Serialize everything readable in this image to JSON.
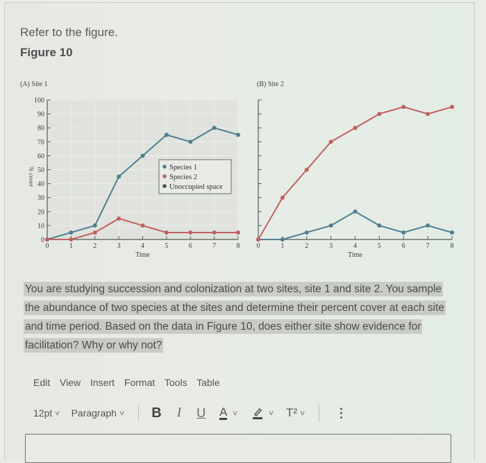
{
  "question": {
    "intro": "Refer to the figure.",
    "figure_title": "Figure 10",
    "text": "You are studying succession and colonization at two sites, site 1 and site 2. You sample the abundance of two species at the sites and determine their percent cover at each site and time period. Based on the data in Figure 10, does either site show evidence for facilitation? Why or why not?"
  },
  "editor": {
    "menu": [
      "Edit",
      "View",
      "Insert",
      "Format",
      "Tools",
      "Table"
    ],
    "font_size": "12pt",
    "block_format": "Paragraph",
    "buttons": {
      "bold": "B",
      "italic": "I",
      "underline": "U",
      "text_color": "A",
      "superscript": "T²",
      "more": "⋮"
    },
    "content": ""
  },
  "colors": {
    "species1": "#4f7f8e",
    "species2": "#c0605e",
    "unoccupied": "#3c5a4a",
    "axis": "#555a55",
    "plot_bg": "#dfe2dd"
  },
  "chart_data": [
    {
      "type": "line",
      "title": "(A) Site 1",
      "xlabel": "Time",
      "ylabel": "% cover",
      "x": [
        0,
        1,
        2,
        3,
        4,
        5,
        6,
        7,
        8
      ],
      "xticks": [
        "0",
        "1",
        "2",
        "3",
        "4",
        "5",
        "6",
        "7",
        "8"
      ],
      "yticks": [
        "0",
        "10",
        "20",
        "30",
        "40",
        "50",
        "60",
        "70",
        "80",
        "90",
        "100"
      ],
      "xlim": [
        0,
        8
      ],
      "ylim": [
        0,
        100
      ],
      "grid": true,
      "legend": {
        "placement": "center-right",
        "entries": [
          "Species 1",
          "Species 2",
          "Unoccupied space"
        ]
      },
      "series": [
        {
          "name": "Species 1",
          "values": [
            0,
            5,
            10,
            45,
            60,
            75,
            70,
            80,
            75
          ]
        },
        {
          "name": "Species 2",
          "values": [
            0,
            0,
            5,
            15,
            10,
            5,
            5,
            5,
            5
          ]
        }
      ]
    },
    {
      "type": "line",
      "title": "(B) Site 2",
      "xlabel": "Time",
      "ylabel": "",
      "x": [
        0,
        1,
        2,
        3,
        4,
        5,
        6,
        7,
        8
      ],
      "xticks": [
        "0",
        "1",
        "2",
        "3",
        "4",
        "5",
        "6",
        "7",
        "8"
      ],
      "yticks": [],
      "xlim": [
        0,
        8
      ],
      "ylim": [
        0,
        100
      ],
      "grid": false,
      "series": [
        {
          "name": "Species 1",
          "values": [
            0,
            0,
            5,
            10,
            20,
            10,
            5,
            10,
            5
          ]
        },
        {
          "name": "Species 2",
          "values": [
            0,
            30,
            50,
            70,
            80,
            90,
            95,
            90,
            95
          ]
        }
      ]
    }
  ]
}
